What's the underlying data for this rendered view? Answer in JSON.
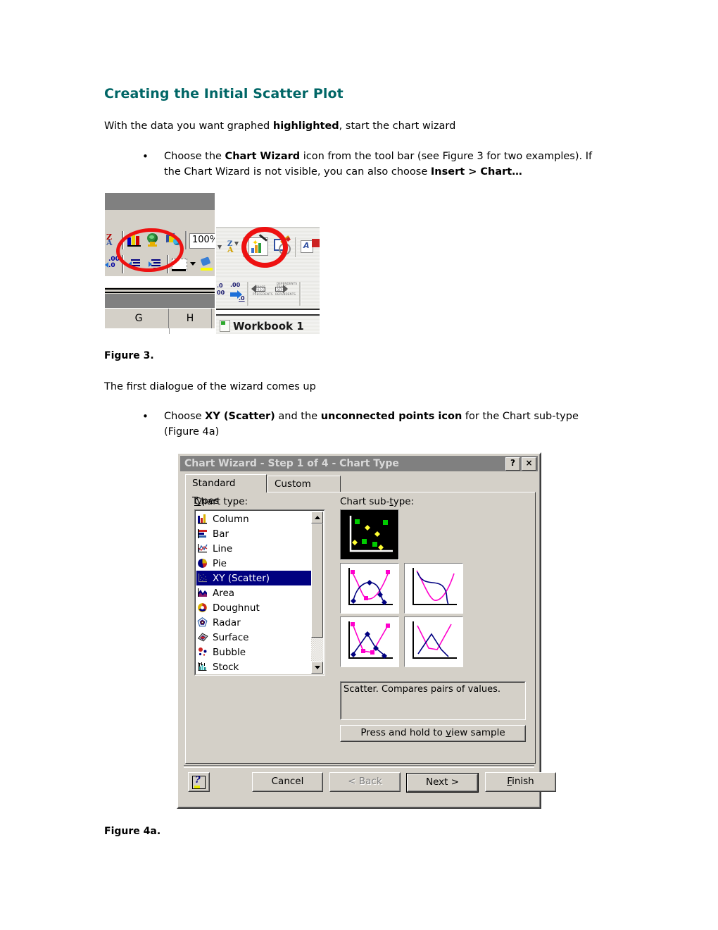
{
  "document": {
    "title": "Creating the Initial Scatter Plot",
    "title_color": "#006666",
    "intro_prefix": "With the data you want graphed ",
    "intro_bold": "highlighted",
    "intro_suffix": ", start the chart wizard",
    "bullet1": {
      "marker": "•",
      "part1": "Choose the ",
      "bold1": "Chart Wizard",
      "part2": " icon from the tool bar (see Figure 3 for two examples). If the Chart Wizard is not visible, you can also choose ",
      "bold2": "Insert > Chart…"
    },
    "figure3_caption": "Figure 3.",
    "paragraph2": "The first dialogue of the wizard comes up",
    "bullet2": {
      "marker": "•",
      "part1": "Choose ",
      "bold1": "XY (Scatter)",
      "part2": " and the ",
      "bold2": "unconnected points icon",
      "part3": " for the Chart sub-type (Figure 4a)"
    },
    "figure4a_caption": "Figure 4a."
  },
  "figure3": {
    "left_toolbar": {
      "zoom_value": "100%",
      "icons": [
        "chart-wizard-icon",
        "globe-icon",
        "drawing-icon",
        "decrease-decimal-icon",
        "decrease-indent-icon",
        "increase-indent-icon",
        "borders-icon",
        "fill-color-icon"
      ],
      "decimal_label_top": ".00",
      "decimal_label_bottom": ".0",
      "column_headers": [
        "G",
        "H"
      ],
      "annotation": "red-circle-highlight"
    },
    "right_toolbar": {
      "icons": [
        "sort-za-icon",
        "chart-wizard-icon",
        "pencil-box-icon",
        "text-box-icon"
      ],
      "decimal_label_top": ".0",
      "decimal_label_mid": ".00",
      "decimal_label_bottom": "00",
      "decimal_label_arrow": ".0",
      "trace_left_label": "TRACE\nPRECEDENTS",
      "trace_right_label": "TRACE\nDEPENDENTS",
      "workbook_label": "Workbook 1",
      "annotation": "red-circle-highlight"
    }
  },
  "dialog": {
    "title": "Chart Wizard - Step 1 of 4 - Chart Type",
    "titlebar_buttons": [
      {
        "name": "help-button",
        "glyph": "?"
      },
      {
        "name": "close-button",
        "glyph": "×"
      }
    ],
    "tabs": [
      {
        "label": "Standard Types",
        "active": true
      },
      {
        "label": "Custom Types",
        "active": false
      }
    ],
    "chart_type_label": "Chart type:",
    "chart_type_label_underlined": "C",
    "chart_types": [
      {
        "label": "Column",
        "icon": "column-chart-icon",
        "selected": false
      },
      {
        "label": "Bar",
        "icon": "bar-chart-icon",
        "selected": false
      },
      {
        "label": "Line",
        "icon": "line-chart-icon",
        "selected": false
      },
      {
        "label": "Pie",
        "icon": "pie-chart-icon",
        "selected": false
      },
      {
        "label": "XY (Scatter)",
        "icon": "scatter-chart-icon",
        "selected": true
      },
      {
        "label": "Area",
        "icon": "area-chart-icon",
        "selected": false
      },
      {
        "label": "Doughnut",
        "icon": "doughnut-chart-icon",
        "selected": false
      },
      {
        "label": "Radar",
        "icon": "radar-chart-icon",
        "selected": false
      },
      {
        "label": "Surface",
        "icon": "surface-chart-icon",
        "selected": false
      },
      {
        "label": "Bubble",
        "icon": "bubble-chart-icon",
        "selected": false
      },
      {
        "label": "Stock",
        "icon": "stock-chart-icon",
        "selected": false
      }
    ],
    "chart_subtype_label": "Chart sub-type:",
    "chart_subtype_label_underlined": "t",
    "chart_subtypes": [
      {
        "name": "scatter-points-only",
        "selected": true,
        "row": 0,
        "col": 0
      },
      {
        "name": "scatter-smooth-lines-markers",
        "selected": false,
        "row": 1,
        "col": 0
      },
      {
        "name": "scatter-smooth-lines",
        "selected": false,
        "row": 1,
        "col": 1
      },
      {
        "name": "scatter-straight-lines-markers",
        "selected": false,
        "row": 2,
        "col": 0
      },
      {
        "name": "scatter-straight-lines",
        "selected": false,
        "row": 2,
        "col": 1
      }
    ],
    "description": "Scatter. Compares pairs of values.",
    "sample_button": "Press and hold to view sample",
    "sample_button_underlined": "v",
    "buttons": [
      {
        "name": "help-button",
        "label": "?",
        "state": "normal",
        "underlined": ""
      },
      {
        "name": "cancel-button",
        "label": "Cancel",
        "state": "normal",
        "underlined": ""
      },
      {
        "name": "back-button",
        "label": "< Back",
        "state": "disabled",
        "underlined": ""
      },
      {
        "name": "next-button",
        "label": "Next >",
        "state": "default",
        "underlined": ""
      },
      {
        "name": "finish-button",
        "label": "Finish",
        "state": "normal",
        "underlined": "F"
      }
    ]
  },
  "colors": {
    "heading": "#006666",
    "dialog_face": "#d4d0c8",
    "titlebar": "#808080",
    "selection": "#000080",
    "subtype_selected_bg": "#000000",
    "marker_green": "#00cc00",
    "marker_yellow": "#ffff33",
    "series_magenta": "#ff00cc",
    "series_navy": "#000080",
    "annotation_red": "#ee1111"
  }
}
